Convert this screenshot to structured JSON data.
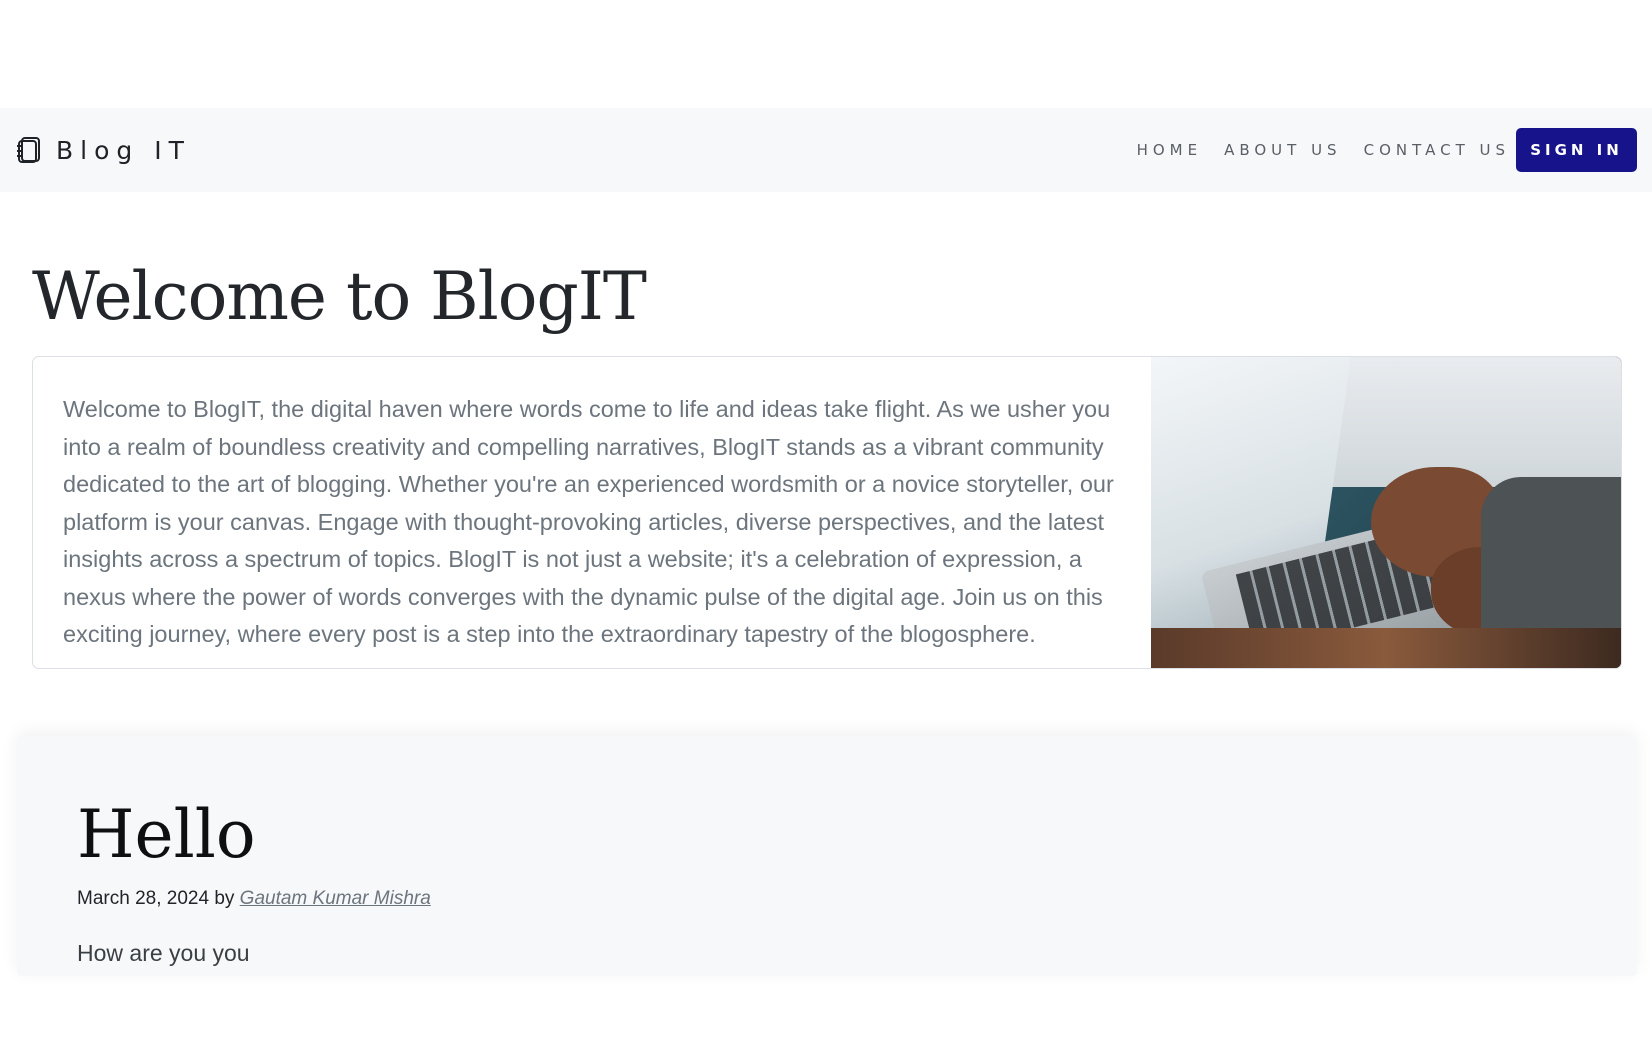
{
  "navbar": {
    "brand_name": "Blog IT",
    "brand_icon": "notebook-icon",
    "links": [
      {
        "label": "HOME"
      },
      {
        "label": "ABOUT US"
      },
      {
        "label": "CONTACT US"
      }
    ],
    "signin_label": "SIGN IN",
    "signin_color": "#17138a"
  },
  "hero": {
    "title": "Welcome to BlogIT",
    "body": "Welcome to BlogIT, the digital haven where words come to life and ideas take flight. As we usher you into a realm of boundless creativity and compelling narratives, BlogIT stands as a vibrant community dedicated to the art of blogging. Whether you're an experienced wordsmith or a novice storyteller, our platform is your canvas. Engage with thought-provoking articles, diverse perspectives, and the latest insights across a spectrum of topics. BlogIT is not just a website; it's a celebration of expression, a nexus where the power of words converges with the dynamic pulse of the digital age. Join us on this exciting journey, where every post is a step into the extraordinary tapestry of the blogosphere.",
    "image": "laptop-typing-photo"
  },
  "post": {
    "title": "Hello",
    "date": "March 28, 2024",
    "by_label": "by",
    "author": "Gautam Kumar Mishra",
    "excerpt": "How are you you"
  }
}
